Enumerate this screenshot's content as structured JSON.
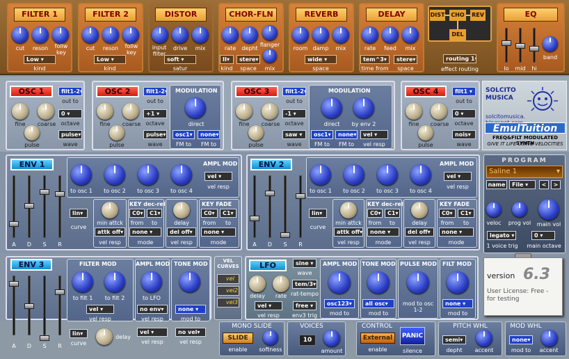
{
  "fx": {
    "filter1": {
      "title": "FILTER 1",
      "k1": "cut",
      "k2": "reson",
      "k3": "follw key",
      "kind_value": "Low",
      "kind_label": "kind"
    },
    "filter2": {
      "title": "FILTER 2",
      "k1": "cut",
      "k2": "reson",
      "k3": "follw key",
      "kind_value": "Low",
      "kind_label": "kind"
    },
    "distor": {
      "title": "DISTOR",
      "k1": "input filter",
      "k2": "drive",
      "k3": "mix",
      "satur_value": "soft",
      "satur_label": "satur"
    },
    "chorfln": {
      "title": "CHOR-FLN",
      "k1": "rate",
      "k2": "depht",
      "k3": "flanger",
      "k4": "mix",
      "kind_value": "II",
      "kind_label": "kind",
      "space_value": "stere",
      "space_label": "space"
    },
    "reverb": {
      "title": "REVERB",
      "k1": "room",
      "k2": "damp",
      "k3": "mix",
      "space_value": "wide",
      "space_label": "space"
    },
    "delay": {
      "title": "DELAY",
      "k1": "rate",
      "k2": "feed",
      "k3": "mix",
      "time_value": "tem^3",
      "time_label": "time from",
      "space_value": "stere",
      "space_label": "space"
    },
    "routing": {
      "dist": "DIST",
      "cho": "CHO",
      "rev": "REV",
      "del": "DEL",
      "value": "routing 1",
      "label": "effect routing"
    },
    "eq": {
      "title": "EQ",
      "lo": "lo",
      "mid": "mid",
      "hi": "hi",
      "band": "band"
    }
  },
  "osc1": {
    "title": "OSC 1",
    "out_value": "filt1-2",
    "out_label": "out to",
    "fine": "fine",
    "coarse": "coarse",
    "oct_value": "0",
    "oct_label": "octave",
    "pulse": "pulse",
    "wave_value": "pulse",
    "wave_label": "wave"
  },
  "osc2": {
    "title": "OSC 2",
    "out_value": "filt1-2",
    "out_label": "out to",
    "fine": "fine",
    "coarse": "coarse",
    "oct_value": "+1",
    "oct_label": "octave",
    "pulse": "pulse",
    "wave_value": "pulse",
    "wave_label": "wave"
  },
  "mod2": {
    "title": "MODULATION",
    "direct": "direct",
    "fm_mod_value": "osc1",
    "fm_mod_label": "FM to",
    "fm_to_value": "none",
    "fm_to_label": "FM to"
  },
  "osc3": {
    "title": "OSC 3",
    "out_value": "filt1-2",
    "out_label": "out to",
    "fine": "fine",
    "coarse": "coarse",
    "oct_value": "-1",
    "oct_label": "octave",
    "pulse": "pulse",
    "wave_value": "saw",
    "wave_label": "wave"
  },
  "mod3": {
    "title": "MODULATION",
    "direct": "direct",
    "env2": "by env 2",
    "fm_mod_value": "osc1",
    "fm_mod_label": "FM to",
    "fm_to_value": "none",
    "fm_to_label": "FM to",
    "vel_value": "vel",
    "vel_label": "vel resp"
  },
  "osc4": {
    "title": "OSC 4",
    "out_value": "filt1",
    "out_label": "out to",
    "fine": "fine",
    "coarse": "coarse",
    "oct_value": "0",
    "oct_label": "octave",
    "pulse": "pulse",
    "wave_value": "nois",
    "wave_label": "wave"
  },
  "logo": {
    "company": "SOLCITO MUSICA",
    "url": "solcitomusica. blogspot.com",
    "product": "EmulTuition",
    "tagline": "FREQ&FILT MODULATED SYNTH",
    "slogan": "GIVE IT LIFE USING VELOCITIES"
  },
  "env1": {
    "title": "ENV 1",
    "a": "A",
    "d": "D",
    "s": "S",
    "r": "R",
    "curve_value": "lin",
    "curve_label": "curve",
    "t1": "to osc 1",
    "t2": "to osc 2",
    "t3": "to osc 3",
    "t4": "to osc 4",
    "ampl_mod": "AMPL MOD",
    "ampl_vel_value": "vel",
    "ampl_vel_label": "vel resp",
    "min_attack": "min attck",
    "attk_value": "attk off",
    "attk_label": "vel resp",
    "keydec": "KEY dec-rel",
    "kd_from": "C0",
    "kd_to": "C1",
    "from": "from",
    "to": "to",
    "mode_value": "none",
    "mode_label": "mode",
    "delay": "delay",
    "del_value": "del off",
    "del_label": "vel resp",
    "keyfade": "KEY FADE",
    "kf_from": "C0",
    "kf_to": "C1",
    "kf_mode_value": "none",
    "kf_mode_label": "mode"
  },
  "env2": {
    "title": "ENV 2",
    "a": "A",
    "d": "D",
    "s": "S",
    "r": "R",
    "curve_value": "lin",
    "curve_label": "curve",
    "t1": "to osc 1",
    "t2": "to osc 2",
    "t3": "to osc 3",
    "t4": "to osc 4",
    "ampl_mod": "AMPL MOD",
    "ampl_vel_value": "vel",
    "ampl_vel_label": "vel resp",
    "min_attack": "min attck",
    "attk_value": "attk off",
    "attk_label": "vel resp",
    "keydec": "KEY dec-rel",
    "kd_from": "C0",
    "kd_to": "C1",
    "from": "from",
    "to": "to",
    "mode_value": "none",
    "mode_label": "mode",
    "delay": "delay",
    "del_value": "del off",
    "del_label": "vel resp",
    "keyfade": "KEY FADE",
    "kf_from": "C0",
    "kf_to": "C1",
    "kf_mode_value": "none",
    "kf_mode_label": "mode"
  },
  "program": {
    "title": "PROGRAM",
    "name_value": "Saline 1",
    "name_btn": "name",
    "file_btn": "File",
    "prev": "<",
    "next": ">",
    "veloc": "veloc",
    "prog_vol": "prog vol",
    "main_vol": "main vol",
    "trig_value": "legato",
    "trig_label": "1 voice trig",
    "oct_value": "0",
    "oct_label": "main octave"
  },
  "env3": {
    "title": "ENV 3",
    "a": "A",
    "d": "D",
    "s": "S",
    "r": "R",
    "curve_value": "lin",
    "curve_label": "curve",
    "filter_mod": "FILTER MOD",
    "tf1": "to filt 1",
    "tf2": "to filt 2",
    "fm_vel_value": "vel",
    "fm_vel_label": "vel resp",
    "ampl_mod": "AMPL MOD",
    "to_lfo": "to LFO",
    "am_vel_value": "no env",
    "am_vel_label": "vel resp",
    "delay": "delay",
    "delay_vel_value": "vel",
    "delay_vel_label": "vel resp",
    "tone_mod": "TONE MOD",
    "tm_to_value": "none",
    "tm_to_label": "mod to",
    "tm_vel_value": "no vel",
    "tm_vel_label": "vel resp"
  },
  "velcurves": {
    "title": "VEL CURVES",
    "v1": "vel",
    "v2": "vel2",
    "v3": "vel3"
  },
  "lfo": {
    "title": "LFO",
    "wave_value": "sine",
    "wave_label": "wave",
    "delay": "delay",
    "rate": "rate",
    "rt_value": "tem/3",
    "rt_label": "rat-tempo",
    "vel_value": "vel",
    "vel_label": "vel resp",
    "trig_value": "free",
    "trig_label": "env3 trig",
    "ampl_mod": "AMPL MOD",
    "am_to_value": "osc123",
    "am_to_label": "mod to",
    "tone_mod": "TONE MOD",
    "tm_to_value": "all osc",
    "tm_to_label": "mod to",
    "pulse_mod": "PULSE MOD",
    "pm_label": "mod to osc 1-2",
    "filt_mod": "FILT MOD",
    "fm_to_value": "none",
    "fm_to_label": "mod to"
  },
  "version": {
    "label": "version",
    "number": "6.3",
    "license": "User License: Free - for testing"
  },
  "bottom": {
    "mono": {
      "title": "MONO SLIDE",
      "btn": "SLIDE",
      "enable": "enable",
      "softness": "softness"
    },
    "voices": {
      "title": "VOICES",
      "value": "10",
      "amount": "amount"
    },
    "control": {
      "title": "CONTROL",
      "btn": "External",
      "enable": "enable",
      "panic": "PANIC",
      "silence": "silence"
    },
    "pitch": {
      "title": "PITCH WHL",
      "value": "semi",
      "depht": "depht",
      "accent": "accent"
    },
    "modwhl": {
      "title": "MOD WHL",
      "value": "none",
      "mod_to": "mod to",
      "accent": "accent"
    }
  }
}
